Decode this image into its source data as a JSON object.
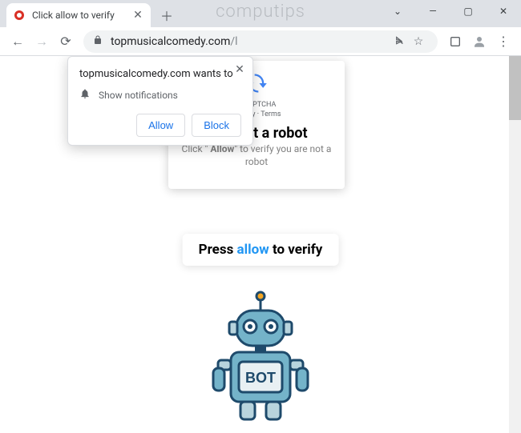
{
  "watermark": "computips",
  "tab": {
    "title": "Click allow to verify"
  },
  "url": {
    "domain": "topmusicalcomedy.com",
    "path": "/l"
  },
  "captcha": {
    "badge": "reCAPTCHA",
    "badge_sub": "Privacy · Terms",
    "heading": "I am not a robot",
    "sub_pre": "Click \" ",
    "sub_bold": "Allow",
    "sub_post": "\" to verify you are not a robot"
  },
  "perm": {
    "heading": "topmusicalcomedy.com wants to",
    "line": "Show notifications",
    "allow": "Allow",
    "block": "Block"
  },
  "banner": {
    "pre": "Press ",
    "blue": "allow",
    "post": " to verify"
  },
  "robot_label": "BOT"
}
